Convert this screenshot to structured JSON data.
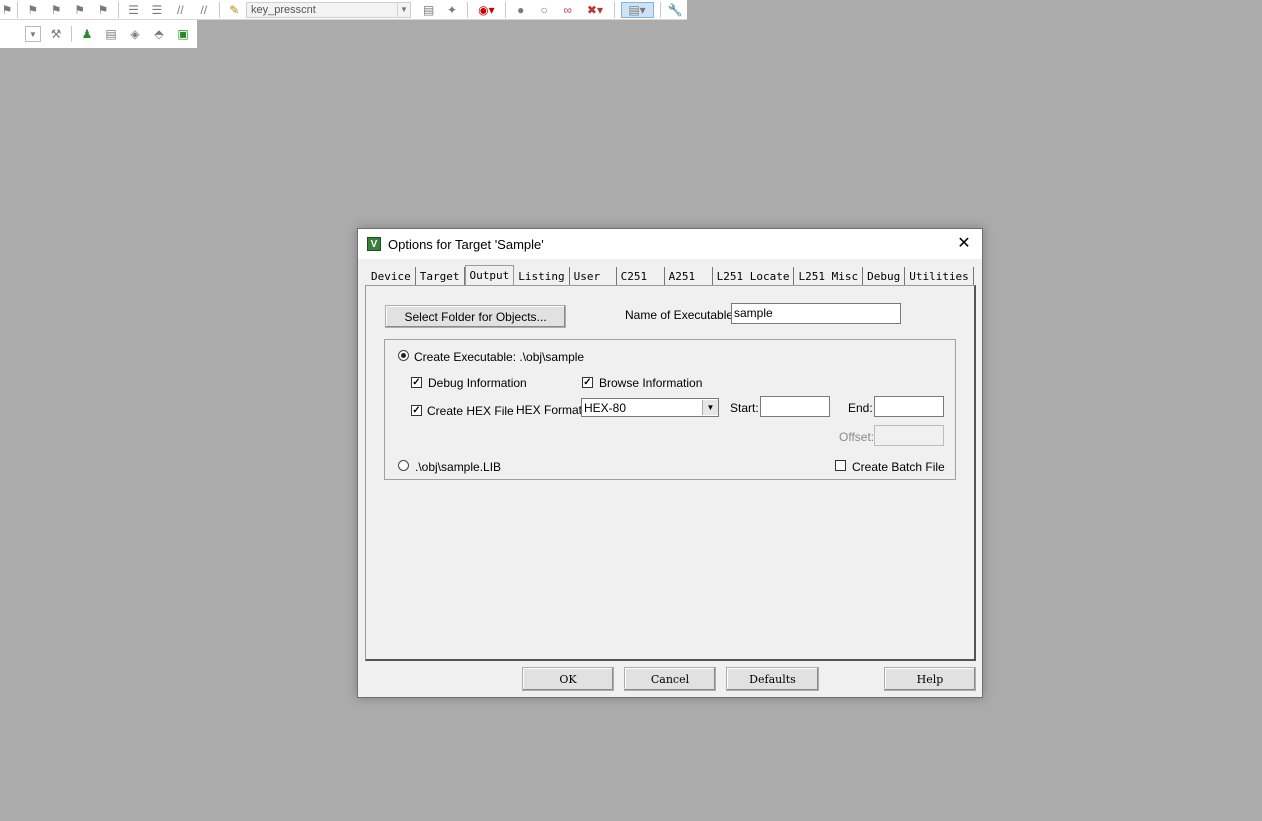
{
  "toolbar1": {
    "combo_value": "key_presscnt"
  },
  "dialog": {
    "title": "Options for Target 'Sample'",
    "close_glyph": "✕",
    "tabs": [
      "Device",
      "Target",
      "Output",
      "Listing",
      "User",
      "C251",
      "A251",
      "L251 Locate",
      "L251 Misc",
      "Debug",
      "Utilities"
    ],
    "active_tab": "Output",
    "output": {
      "select_folder_label": "Select Folder for Objects...",
      "name_exec_label": "Name of Executable:",
      "name_exec_value": "sample",
      "create_exec_label": "Create Executable:  .\\obj\\sample",
      "create_exec_selected": true,
      "debug_info_label": "Debug Information",
      "debug_info_checked": true,
      "browse_info_label": "Browse Information",
      "browse_info_checked": true,
      "create_hex_label": "Create HEX File",
      "create_hex_checked": true,
      "hex_format_label": "HEX Format:",
      "hex_format_value": "HEX-80",
      "start_label": "Start:",
      "start_value": "",
      "end_label": "End:",
      "end_value": "",
      "offset_label": "Offset:",
      "offset_value": "",
      "lib_label": ".\\obj\\sample.LIB",
      "lib_selected": false,
      "batch_label": "Create Batch File",
      "batch_checked": false
    },
    "buttons": {
      "ok": "OK",
      "cancel": "Cancel",
      "defaults": "Defaults",
      "help": "Help"
    }
  },
  "icons": {
    "check_glyph": "✓"
  }
}
